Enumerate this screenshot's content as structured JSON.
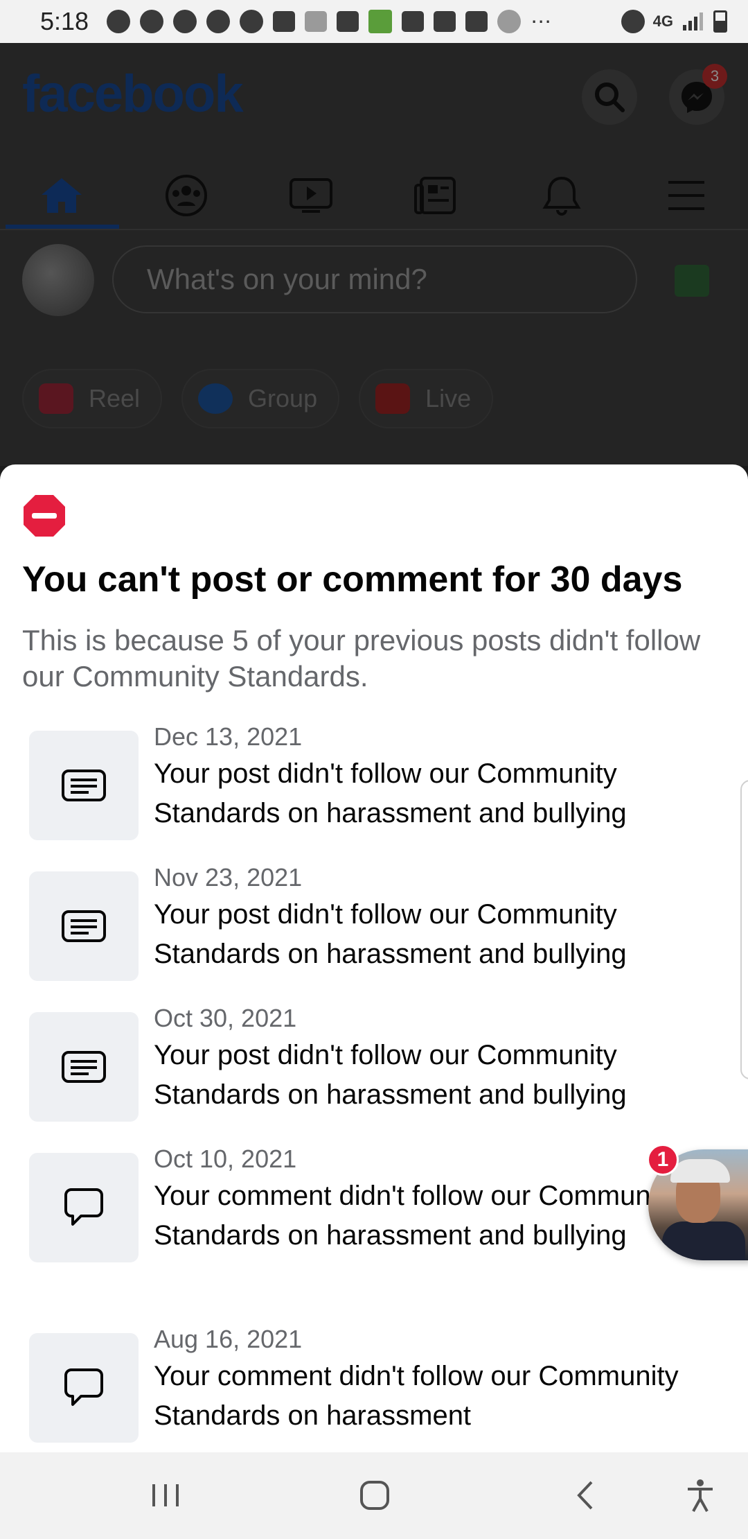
{
  "status_bar": {
    "time": "5:18"
  },
  "app": {
    "logo": "facebook",
    "messenger_badge": "3",
    "composer_placeholder": "What's on your mind?",
    "chips": [
      {
        "label": "Reel",
        "icon": "reel-icon",
        "color": "#b0263a"
      },
      {
        "label": "Group",
        "icon": "group-icon",
        "color": "#1a4c8c"
      },
      {
        "label": "Live",
        "icon": "live-icon",
        "color": "#8c1a1a"
      }
    ]
  },
  "sheet": {
    "title": "You can't post or comment for 30 days",
    "subtitle": "This is because 5 of your previous posts didn't follow our Community Standards.",
    "violations": [
      {
        "date": "Dec 13, 2021",
        "text": "Your post didn't follow our Community Standards on harassment and bullying",
        "icon": "post-icon"
      },
      {
        "date": "Nov 23, 2021",
        "text": "Your post didn't follow our Community Standards on harassment and bullying",
        "icon": "post-icon"
      },
      {
        "date": "Oct 30, 2021",
        "text": "Your post didn't follow our Community Standards on harassment and bullying",
        "icon": "post-icon"
      },
      {
        "date": "Oct 10, 2021",
        "text": "Your comment didn't follow our Community Standards on harassment and bullying",
        "icon": "comment-icon"
      },
      {
        "date": "Aug 16, 2021",
        "text": "Your comment didn't follow our Community Standards on harassment",
        "icon": "comment-icon"
      }
    ]
  },
  "chat_head": {
    "badge": "1"
  },
  "colors": {
    "stop_red": "#e41e3f",
    "text_primary": "#050505",
    "text_secondary": "#65676b",
    "thumb_bg": "#eef0f3"
  }
}
